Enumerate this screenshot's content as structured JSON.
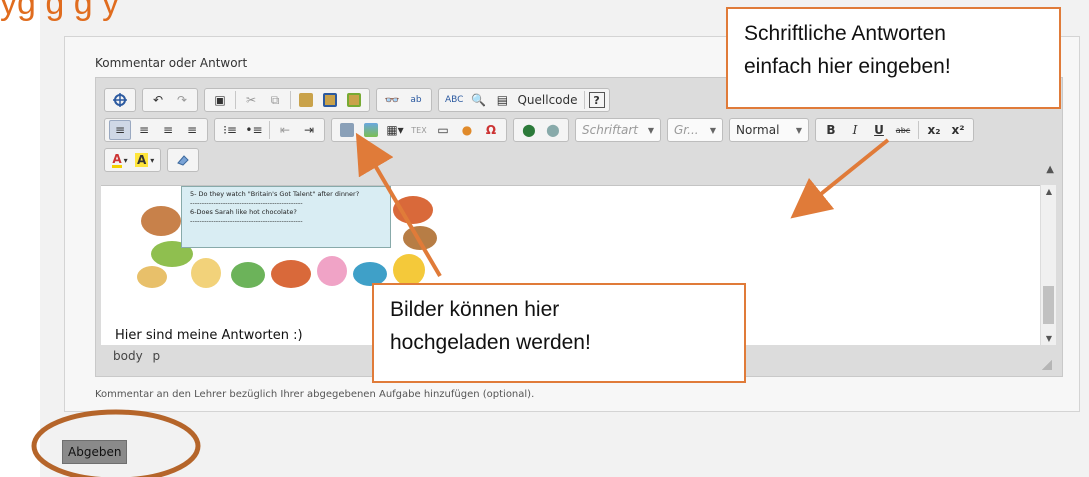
{
  "page": {
    "heading_fragment": "yg g   g            y"
  },
  "form": {
    "field_label": "Kommentar oder Antwort",
    "help_text": "Kommentar an den Lehrer bezüglich Ihrer abgegebenen Aufgabe hinzufügen (optional).",
    "submit_label": "Abgeben"
  },
  "toolbar": {
    "source_label": "Quellcode",
    "font_placeholder": "Schriftart",
    "size_placeholder": "Gr...",
    "format_value": "Normal",
    "icons": [
      "maximize-icon",
      "undo-icon",
      "redo-icon",
      "select-all-icon",
      "cut-icon",
      "copy-icon",
      "paste-icon",
      "paste-text-icon",
      "paste-word-icon",
      "find-icon",
      "replace-icon",
      "spellcheck-icon",
      "preview-icon",
      "templates-icon",
      "source-icon",
      "help-icon",
      "align-left-icon",
      "align-center-icon",
      "align-right-icon",
      "justify-icon",
      "numbered-list-icon",
      "bullet-list-icon",
      "outdent-icon",
      "indent-icon",
      "image-upload-icon",
      "image-icon",
      "table-icon",
      "tex-icon",
      "hr-icon",
      "smiley-icon",
      "omega-icon",
      "link-icon",
      "unlink-icon",
      "text-color-icon",
      "bg-color-icon",
      "eraser-icon"
    ],
    "bold": "B",
    "underline": "U",
    "strike": "abc",
    "subscript": "x₂",
    "superscript": "x²",
    "tex_label": "TEX",
    "omega": "Ω",
    "help": "?"
  },
  "editor": {
    "worksheet_lines": [
      "5- Do they watch \"Britain's Got Talent\" after dinner?",
      "------------------------------------------------",
      "6-Does Sarah like hot chocolate?",
      "------------------------------------------------"
    ],
    "answer_text": "Hier sind meine Antworten :)",
    "path": "body  p"
  },
  "callouts": {
    "top": [
      "Schriftliche Antworten",
      "einfach hier eingeben!"
    ],
    "middle": [
      "Bilder können hier",
      "hochgeladen werden!"
    ]
  },
  "colors": {
    "accent": "#e07b39",
    "heading": "#e06c1e",
    "submit_bg": "#8a8a8a"
  }
}
